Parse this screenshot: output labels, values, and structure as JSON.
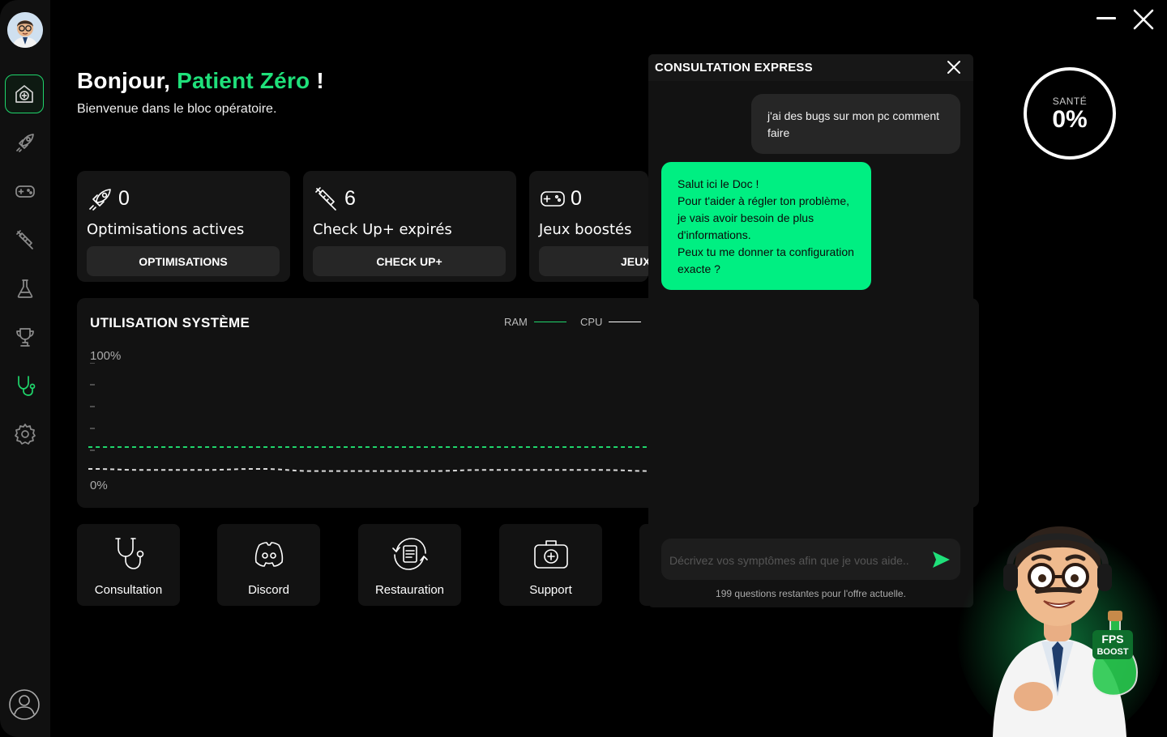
{
  "greeting": {
    "prefix": "Bonjour,",
    "name": "Patient Zéro",
    "suffix": "!",
    "subtitle": "Bienvenue dans le bloc opératoire."
  },
  "colors": {
    "accent": "#1fe07a",
    "bot_bubble": "#00ef82",
    "panel": "#151515",
    "background": "#000000"
  },
  "sidebar": {
    "items": [
      {
        "icon": "home-plus-icon",
        "active": true
      },
      {
        "icon": "rocket-icon"
      },
      {
        "icon": "gamepad-icon"
      },
      {
        "icon": "syringe-icon"
      },
      {
        "icon": "flask-icon"
      },
      {
        "icon": "trophy-icon"
      },
      {
        "icon": "stethoscope-icon",
        "highlight": true
      },
      {
        "icon": "gear-icon"
      }
    ]
  },
  "cards": [
    {
      "count": "0",
      "label": "Optimisations actives",
      "button": "OPTIMISATIONS",
      "icon": "rocket-icon"
    },
    {
      "count": "6",
      "label": "Check Up+ expirés",
      "button": "CHECK UP+",
      "icon": "syringe-icon"
    },
    {
      "count": "0",
      "label": "Jeux boostés",
      "button": "JEUX",
      "icon": "gamepad-icon"
    }
  ],
  "usage": {
    "title": "UTILISATION SYSTÈME",
    "legend": [
      {
        "name": "RAM",
        "color": "#1fd56b"
      },
      {
        "name": "CPU",
        "color": "#ffffff"
      }
    ],
    "axis_top": "100%",
    "axis_bottom": "0%"
  },
  "chart_data": {
    "type": "line",
    "ylim": [
      0,
      100
    ],
    "series": [
      {
        "name": "RAM",
        "color": "#1fd56b",
        "values": [
          23,
          23,
          23,
          23,
          23,
          23,
          23,
          23,
          23,
          23,
          23
        ]
      },
      {
        "name": "CPU",
        "color": "#ffffff",
        "values": [
          3,
          2,
          2,
          3,
          1,
          1,
          1,
          2,
          2,
          2,
          1
        ]
      }
    ]
  },
  "quick_actions": [
    {
      "label": "Consultation",
      "icon": "stethoscope-icon"
    },
    {
      "label": "Discord",
      "icon": "discord-icon"
    },
    {
      "label": "Restauration",
      "icon": "restore-icon"
    },
    {
      "label": "Support",
      "icon": "first-aid-kit-icon"
    }
  ],
  "health": {
    "label": "SANTÉ",
    "value": "0%"
  },
  "chat": {
    "title": "CONSULTATION EXPRESS",
    "user_message": "j'ai des bugs sur mon pc comment faire",
    "bot_message": "Salut ici le Doc !\nPour t'aider à régler ton problème, je vais avoir besoin de plus d'informations.\nPeux tu me donner ta configuration exacte ?",
    "input_placeholder": "Décrivez vos symptômes afin que je vous aide..",
    "remaining": "199 questions restantes pour l'offre actuelle."
  },
  "mascot": {
    "badge_line1": "FPS",
    "badge_line2": "BOOST"
  }
}
